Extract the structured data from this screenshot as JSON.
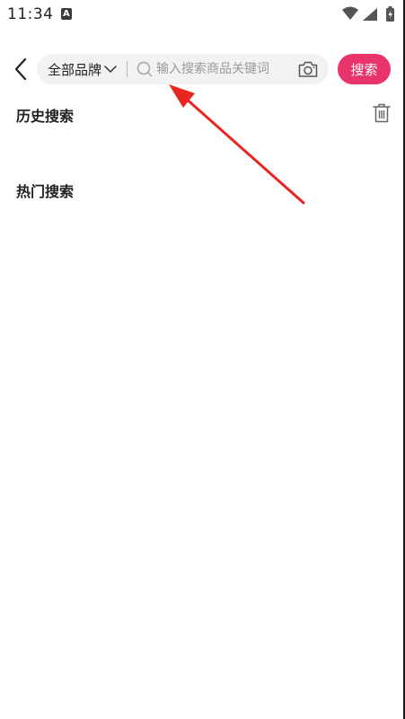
{
  "status_bar": {
    "time": "11:34",
    "notification_icon": "A"
  },
  "search_bar": {
    "brand_filter": "全部品牌",
    "placeholder": "输入搜索商品关键词",
    "value": "",
    "search_button": "搜索"
  },
  "sections": {
    "history": {
      "title": "历史搜索"
    },
    "hot": {
      "title": "热门搜索"
    }
  },
  "colors": {
    "accent": "#e8336b",
    "annotation": "#e8251f"
  }
}
